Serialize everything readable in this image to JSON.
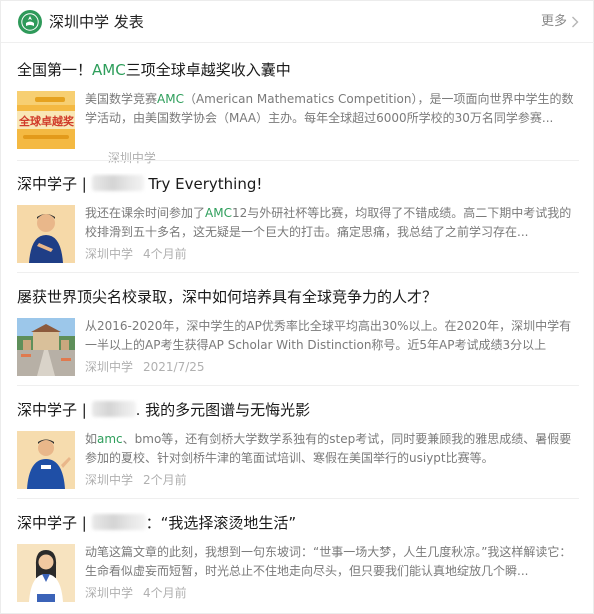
{
  "header": {
    "account_name": "深圳中学 发表",
    "more_label": "更多",
    "logo_icon": "school-emblem-icon",
    "brand_color": "#2f9a5a"
  },
  "articles": [
    {
      "title_pre": "全国第一！",
      "title_accent": "AMC",
      "title_post": "三项全球卓越奖收入囊中",
      "summary_pre": "美国数学竞赛",
      "summary_accent": "AMC",
      "summary_post": "（American Mathematics Competition），是一项面向世界中学生的数学活动，由美国数学协会（MAA）主办。每年全球超过6000所学校的30万名同学参赛...",
      "source": "深圳中学",
      "time": "",
      "thumb_text": "全球卓越奖"
    },
    {
      "title_pre": "深中学子 | ",
      "title_accent": "",
      "title_post": " Try Everything!",
      "summary_pre": "我还在课余时间参加了",
      "summary_accent": "AMC",
      "summary_post": "12与外研社杯等比赛，均取得了不错成绩。高二下期中考试我的校排滑到五十多名，这无疑是一个巨大的打击。痛定思痛，我总结了之前学习存在...",
      "source": "深圳中学",
      "time": "4个月前"
    },
    {
      "title_pre": "屡获世界顶尖名校录取，深中如何培养具有全球竞争力的人才？",
      "title_accent": "",
      "title_post": "",
      "summary_pre": "从2016-2020年，深中学生的AP优秀率比全球平均高出30%以上。在2020年，深圳中学有一半以上的AP考生获得AP Scholar With Distinction称号。近5年AP考试成绩3分以上",
      "summary_accent": "",
      "summary_post": "",
      "source": "深圳中学",
      "time": "2021/7/25"
    },
    {
      "title_pre": "深中学子 | ",
      "title_accent": "",
      "title_post": ". 我的多元图谱与无悔光影",
      "summary_pre": "如",
      "summary_accent": "amc",
      "summary_post": "、bmo等，还有剑桥大学数学系独有的step考试，同时要兼顾我的雅思成绩、暑假要参加的夏校、针对剑桥牛津的笔面试培训、寒假在美国举行的usiypt比赛等。",
      "source": "深圳中学",
      "time": "2个月前"
    },
    {
      "title_pre": "深中学子 | ",
      "title_accent": "",
      "title_post": "：“我选择滚烫地生活”",
      "summary_pre": "动笔这篇文章的此刻，我想到一句东坡词：“世事一场大梦，人生几度秋凉。”我这样解读它：生命看似虚妄而短暂，时光总止不住地走向尽头，但只要我们能认真地绽放几个瞬...",
      "summary_accent": "",
      "summary_post": "",
      "source": "深圳中学",
      "time": "4个月前"
    }
  ]
}
